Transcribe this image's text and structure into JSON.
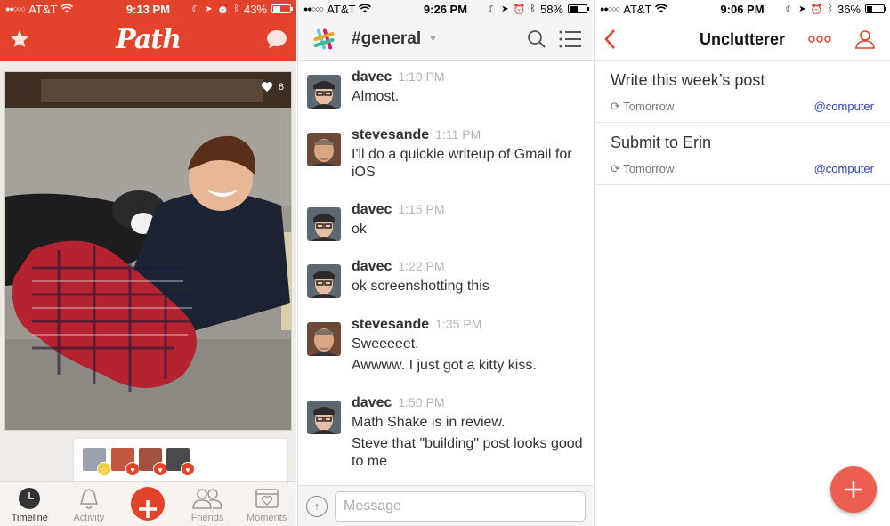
{
  "path_screen": {
    "status": {
      "carrier": "AT&T",
      "time": "9:13 PM",
      "battery": "43%",
      "battery_level": 0.43
    },
    "logo": "Path",
    "like_count": "8",
    "tabs": [
      {
        "label": "Timeline",
        "icon": "clock-icon",
        "active": true
      },
      {
        "label": "Activity",
        "icon": "bell-icon",
        "active": false
      },
      {
        "label": "",
        "icon": "plus-icon",
        "active": false
      },
      {
        "label": "Friends",
        "icon": "friends-icon",
        "active": false
      },
      {
        "label": "Moments",
        "icon": "moments-icon",
        "active": false
      }
    ],
    "accent": "#e4432b"
  },
  "slack_screen": {
    "status": {
      "carrier": "AT&T",
      "time": "9:26 PM",
      "battery": "58%",
      "battery_level": 0.58
    },
    "channel": "#general",
    "messages": [
      {
        "user": "davec",
        "time": "1:10 PM",
        "lines": [
          "Almost."
        ]
      },
      {
        "user": "stevesande",
        "time": "1:11 PM",
        "lines": [
          "I'll do a quickie writeup of Gmail for iOS"
        ]
      },
      {
        "user": "davec",
        "time": "1:15 PM",
        "lines": [
          "ok"
        ]
      },
      {
        "user": "davec",
        "time": "1:22 PM",
        "lines": [
          "ok screenshotting this"
        ]
      },
      {
        "user": "stevesande",
        "time": "1:35 PM",
        "lines": [
          "Sweeeeet.",
          "Awwww. I just got a kitty kiss."
        ]
      },
      {
        "user": "davec",
        "time": "1:50 PM",
        "lines": [
          "Math Shake is in review.",
          "Steve that \"building\" post looks good to me"
        ]
      }
    ],
    "input_placeholder": "Message"
  },
  "todo_screen": {
    "status": {
      "carrier": "AT&T",
      "time": "9:06 PM",
      "battery": "36%",
      "battery_level": 0.36
    },
    "title": "Unclutterer",
    "tasks": [
      {
        "title": "Write this week’s post",
        "due": "Tomorrow",
        "context": "@computer"
      },
      {
        "title": "Submit to Erin",
        "due": "Tomorrow",
        "context": "@computer"
      }
    ],
    "accent": "#e4432b"
  }
}
